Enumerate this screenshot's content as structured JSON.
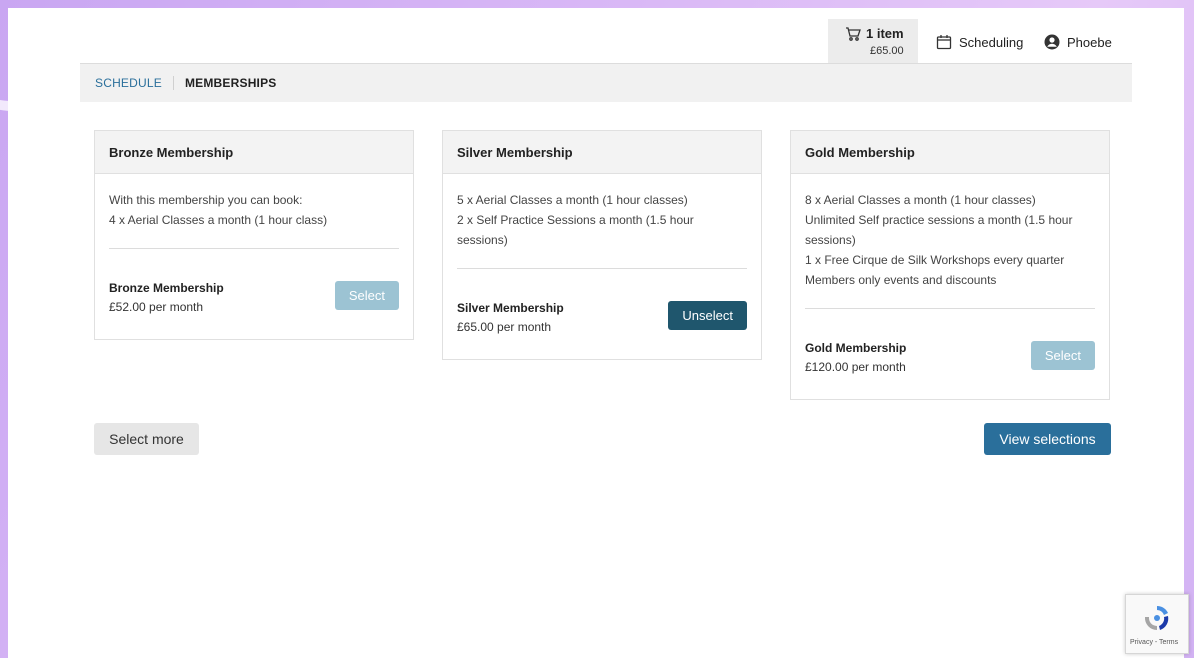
{
  "header": {
    "cart": {
      "count_label": "1 item",
      "total": "£65.00"
    },
    "scheduling_label": "Scheduling",
    "user_name": "Phoebe"
  },
  "breadcrumb": {
    "link": "SCHEDULE",
    "current": "MEMBERSHIPS"
  },
  "memberships": [
    {
      "title": "Bronze Membership",
      "features": [
        "With this membership you can book:",
        "4 x Aerial Classes a month (1 hour class)"
      ],
      "name": "Bronze Membership",
      "price": "£52.00 per month",
      "button_label": "Select",
      "selected": false
    },
    {
      "title": "Silver Membership",
      "features": [
        "5 x Aerial Classes a month (1 hour classes)",
        "2 x Self Practice Sessions a month (1.5 hour",
        "sessions)"
      ],
      "name": "Silver Membership",
      "price": "£65.00 per month",
      "button_label": "Unselect",
      "selected": true
    },
    {
      "title": "Gold Membership",
      "features": [
        "8 x Aerial Classes a month (1 hour classes)",
        "Unlimited Self practice sessions a month (1.5 hour",
        "sessions)",
        "1 x Free Cirque de Silk Workshops every quarter",
        "Members only events and discounts"
      ],
      "name": "Gold Membership",
      "price": "£120.00 per month",
      "button_label": "Select",
      "selected": false
    }
  ],
  "actions": {
    "select_more": "Select more",
    "view_selections": "View selections"
  },
  "recaptcha": {
    "terms": "Privacy - Terms"
  },
  "colors": {
    "primary": "#2a6f9b",
    "unselect": "#1f566d",
    "select_disabled": "#9cc3d3"
  },
  "icons": {
    "cart": "cart-icon",
    "scheduling": "calendar-icon",
    "user": "user-circle-icon"
  }
}
